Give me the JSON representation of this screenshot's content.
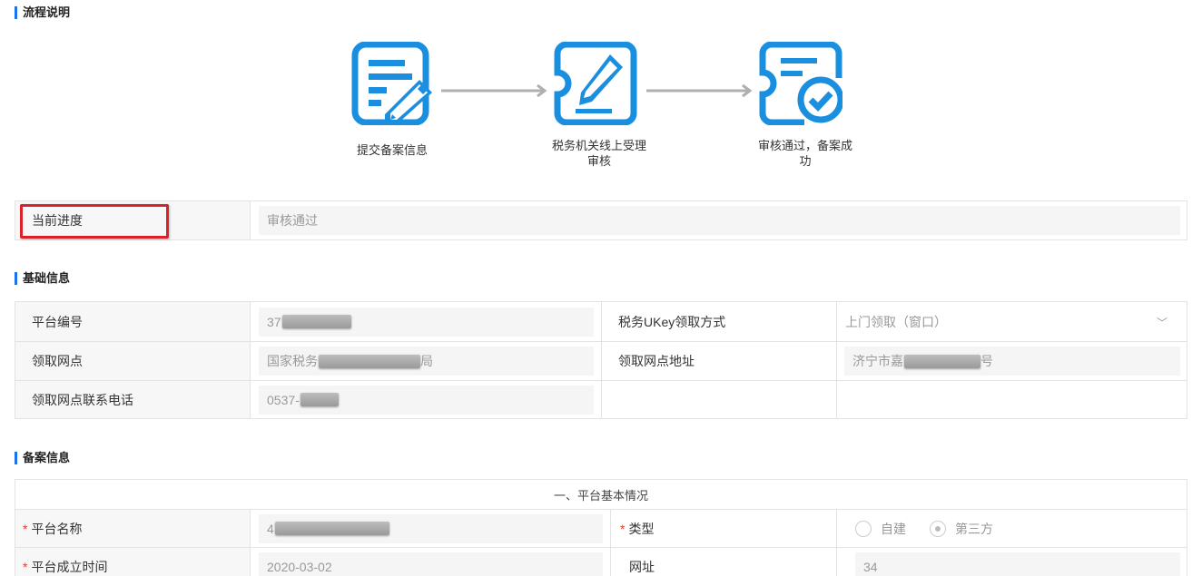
{
  "sections": {
    "flow_title": "流程说明",
    "basic_title": "基础信息",
    "filing_title": "备案信息"
  },
  "flow": {
    "steps": [
      {
        "label": "提交备案信息",
        "icon": "document-edit-icon"
      },
      {
        "label": "税务机关线上受理审核",
        "icon": "ticket-edit-icon"
      },
      {
        "label": "审核通过，备案成功",
        "icon": "ticket-check-icon"
      }
    ],
    "accent": "#1a8fe0",
    "arrow_color": "#b0b0b0"
  },
  "progress": {
    "label": "当前进度",
    "value": "审核通过"
  },
  "basic": {
    "platform_no_label": "平台编号",
    "platform_no_value": "37",
    "ukey_label": "税务UKey领取方式",
    "ukey_value": "上门领取（窗口）",
    "pickup_point_label": "领取网点",
    "pickup_point_value": "国家税务",
    "pickup_point_value_tail": "局",
    "pickup_addr_label": "领取网点地址",
    "pickup_addr_value": "济宁市嘉",
    "pickup_addr_value_tail": "号",
    "phone_label": "领取网点联系电话",
    "phone_value": "0537-"
  },
  "filing": {
    "group_title": "一、平台基本情况",
    "platform_name_label": "平台名称",
    "platform_name_value": "4",
    "type_label": "类型",
    "type_options": [
      "自建",
      "第三方"
    ],
    "type_selected": "第三方",
    "founded_label": "平台成立时间",
    "founded_value": "2020-03-02",
    "url_label": "网址",
    "url_value": "34"
  },
  "colors": {
    "highlight": "#d8232a",
    "required": "#e53935",
    "section_bar": "#1a73e8"
  }
}
